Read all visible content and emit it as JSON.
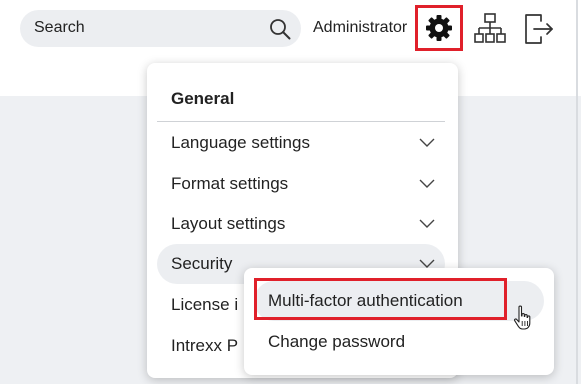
{
  "header": {
    "search": {
      "placeholder": "Search",
      "icon": "search-icon"
    },
    "user_name": "Administrator",
    "icons": [
      "gear-icon",
      "sitemap-icon",
      "logout-icon"
    ]
  },
  "settings_menu": {
    "heading": "General",
    "items": [
      {
        "label": "Language settings",
        "icon": "chevron-down-icon"
      },
      {
        "label": "Format settings",
        "icon": "chevron-down-icon"
      },
      {
        "label": "Layout settings",
        "icon": "chevron-down-icon"
      },
      {
        "label": "Security",
        "icon": "chevron-down-icon",
        "active": true
      },
      {
        "label": "License i"
      },
      {
        "label": "Intrexx P"
      }
    ]
  },
  "security_submenu": {
    "items": [
      {
        "label": "Multi-factor authentication",
        "highlighted": true
      },
      {
        "label": "Change password"
      }
    ]
  },
  "colors": {
    "highlight_border": "#e0202a",
    "content_background": "#eef0f3",
    "active_item_background": "#eceef1"
  }
}
